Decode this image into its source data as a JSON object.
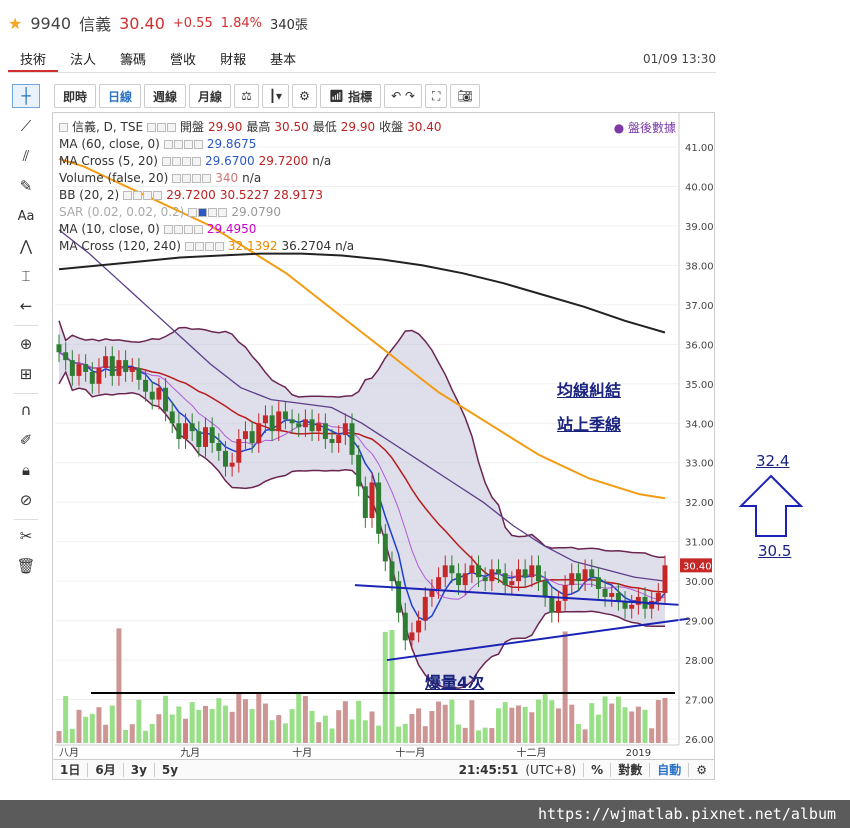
{
  "header": {
    "code": "9940",
    "name": "信義",
    "price": "30.40",
    "change": "+0.55",
    "change_pct": "1.84%",
    "volume": "340張"
  },
  "nav": {
    "tabs": [
      "技術",
      "法人",
      "籌碼",
      "營收",
      "財報",
      "基本"
    ],
    "datetime": "01/09 13:30"
  },
  "toolbar": {
    "buttons": [
      "即時",
      "日線",
      "週線",
      "月線"
    ],
    "indicators_label": "指標"
  },
  "legend": {
    "main": {
      "name": "信義, D, TSE",
      "open_label": "開盤",
      "open": "29.90",
      "high_label": "最高",
      "high": "30.50",
      "low_label": "最低",
      "low": "29.90",
      "close_label": "收盤",
      "close": "30.40"
    },
    "rows": [
      {
        "name": "MA (60, close, 0)",
        "values": [
          "29.8675"
        ]
      },
      {
        "name": "MA Cross (5, 20)",
        "values": [
          "29.6700",
          "29.7200",
          "n/a"
        ]
      },
      {
        "name": "Volume (false, 20)",
        "values": [
          "340",
          "n/a"
        ]
      },
      {
        "name": "BB (20, 2)",
        "values": [
          "29.7200",
          "30.5227",
          "28.9173"
        ]
      },
      {
        "name": "SAR (0.02, 0.02, 0.2)",
        "values": [
          "29.0790"
        ]
      },
      {
        "name": "MA (10, close, 0)",
        "values": [
          "29.4950"
        ]
      },
      {
        "name": "MA Cross (120, 240)",
        "values": [
          "32.1392",
          "36.2704",
          "n/a"
        ]
      }
    ]
  },
  "aftermarket_label": "盤後數據",
  "annotations": {
    "ma_tangle": "均線糾結",
    "above_quarter": "站上季線",
    "volume_burst": "爆量4次",
    "target_high": "32.4",
    "target_low": "30.5"
  },
  "bottom_bar": {
    "ranges": [
      "1日",
      "6月",
      "3y",
      "5y"
    ],
    "time": "21:45:51",
    "tz": "(UTC+8)",
    "pct": "%",
    "log": "對數",
    "auto": "自動"
  },
  "watermark": "https://wjmatlab.pixnet.net/album",
  "colors": {
    "up": "#c62828",
    "down": "#2e7d32",
    "ma60": "#f39c12",
    "ma240": "#222222",
    "ma120": "#5b3f8a",
    "bb": "#6a2550",
    "trend": "#1a23b5"
  },
  "chart_data": {
    "type": "candlestick",
    "y_axis": {
      "min": 26.0,
      "max": 41.0,
      "ticks": [
        26,
        27,
        28,
        29,
        30,
        31,
        32,
        33,
        34,
        35,
        36,
        37,
        38,
        39,
        40,
        41
      ],
      "last_price": 30.4
    },
    "x_axis_labels": [
      "八月",
      "九月",
      "十月",
      "十一月",
      "十二月",
      "2019"
    ],
    "volume_ref_line": "horizontal black line",
    "close_series_approx": [
      35.8,
      35.6,
      35.2,
      35.5,
      35.3,
      35.0,
      35.4,
      35.7,
      35.2,
      35.6,
      35.3,
      35.4,
      35.1,
      34.8,
      34.6,
      34.9,
      34.3,
      34.0,
      33.6,
      34.0,
      33.8,
      33.4,
      33.9,
      33.5,
      33.3,
      32.9,
      33.0,
      33.6,
      33.8,
      33.5,
      34.0,
      34.2,
      33.8,
      34.3,
      34.1,
      34.0,
      33.9,
      34.1,
      33.8,
      34.0,
      33.6,
      33.5,
      33.7,
      34.0,
      33.2,
      32.4,
      31.6,
      32.5,
      31.2,
      30.5,
      30.0,
      29.2,
      28.5,
      28.7,
      29.0,
      29.6,
      29.8,
      30.1,
      30.4,
      30.2,
      29.9,
      30.2,
      30.4,
      30.1,
      30.0,
      30.3,
      30.2,
      29.9,
      30.0,
      30.3,
      30.1,
      30.4,
      30.0,
      29.6,
      29.2,
      29.5,
      29.9,
      30.2,
      30.0,
      30.3,
      30.1,
      29.8,
      29.6,
      29.7,
      29.5,
      29.3,
      29.4,
      29.6,
      29.3,
      29.5,
      29.7,
      30.4
    ]
  }
}
